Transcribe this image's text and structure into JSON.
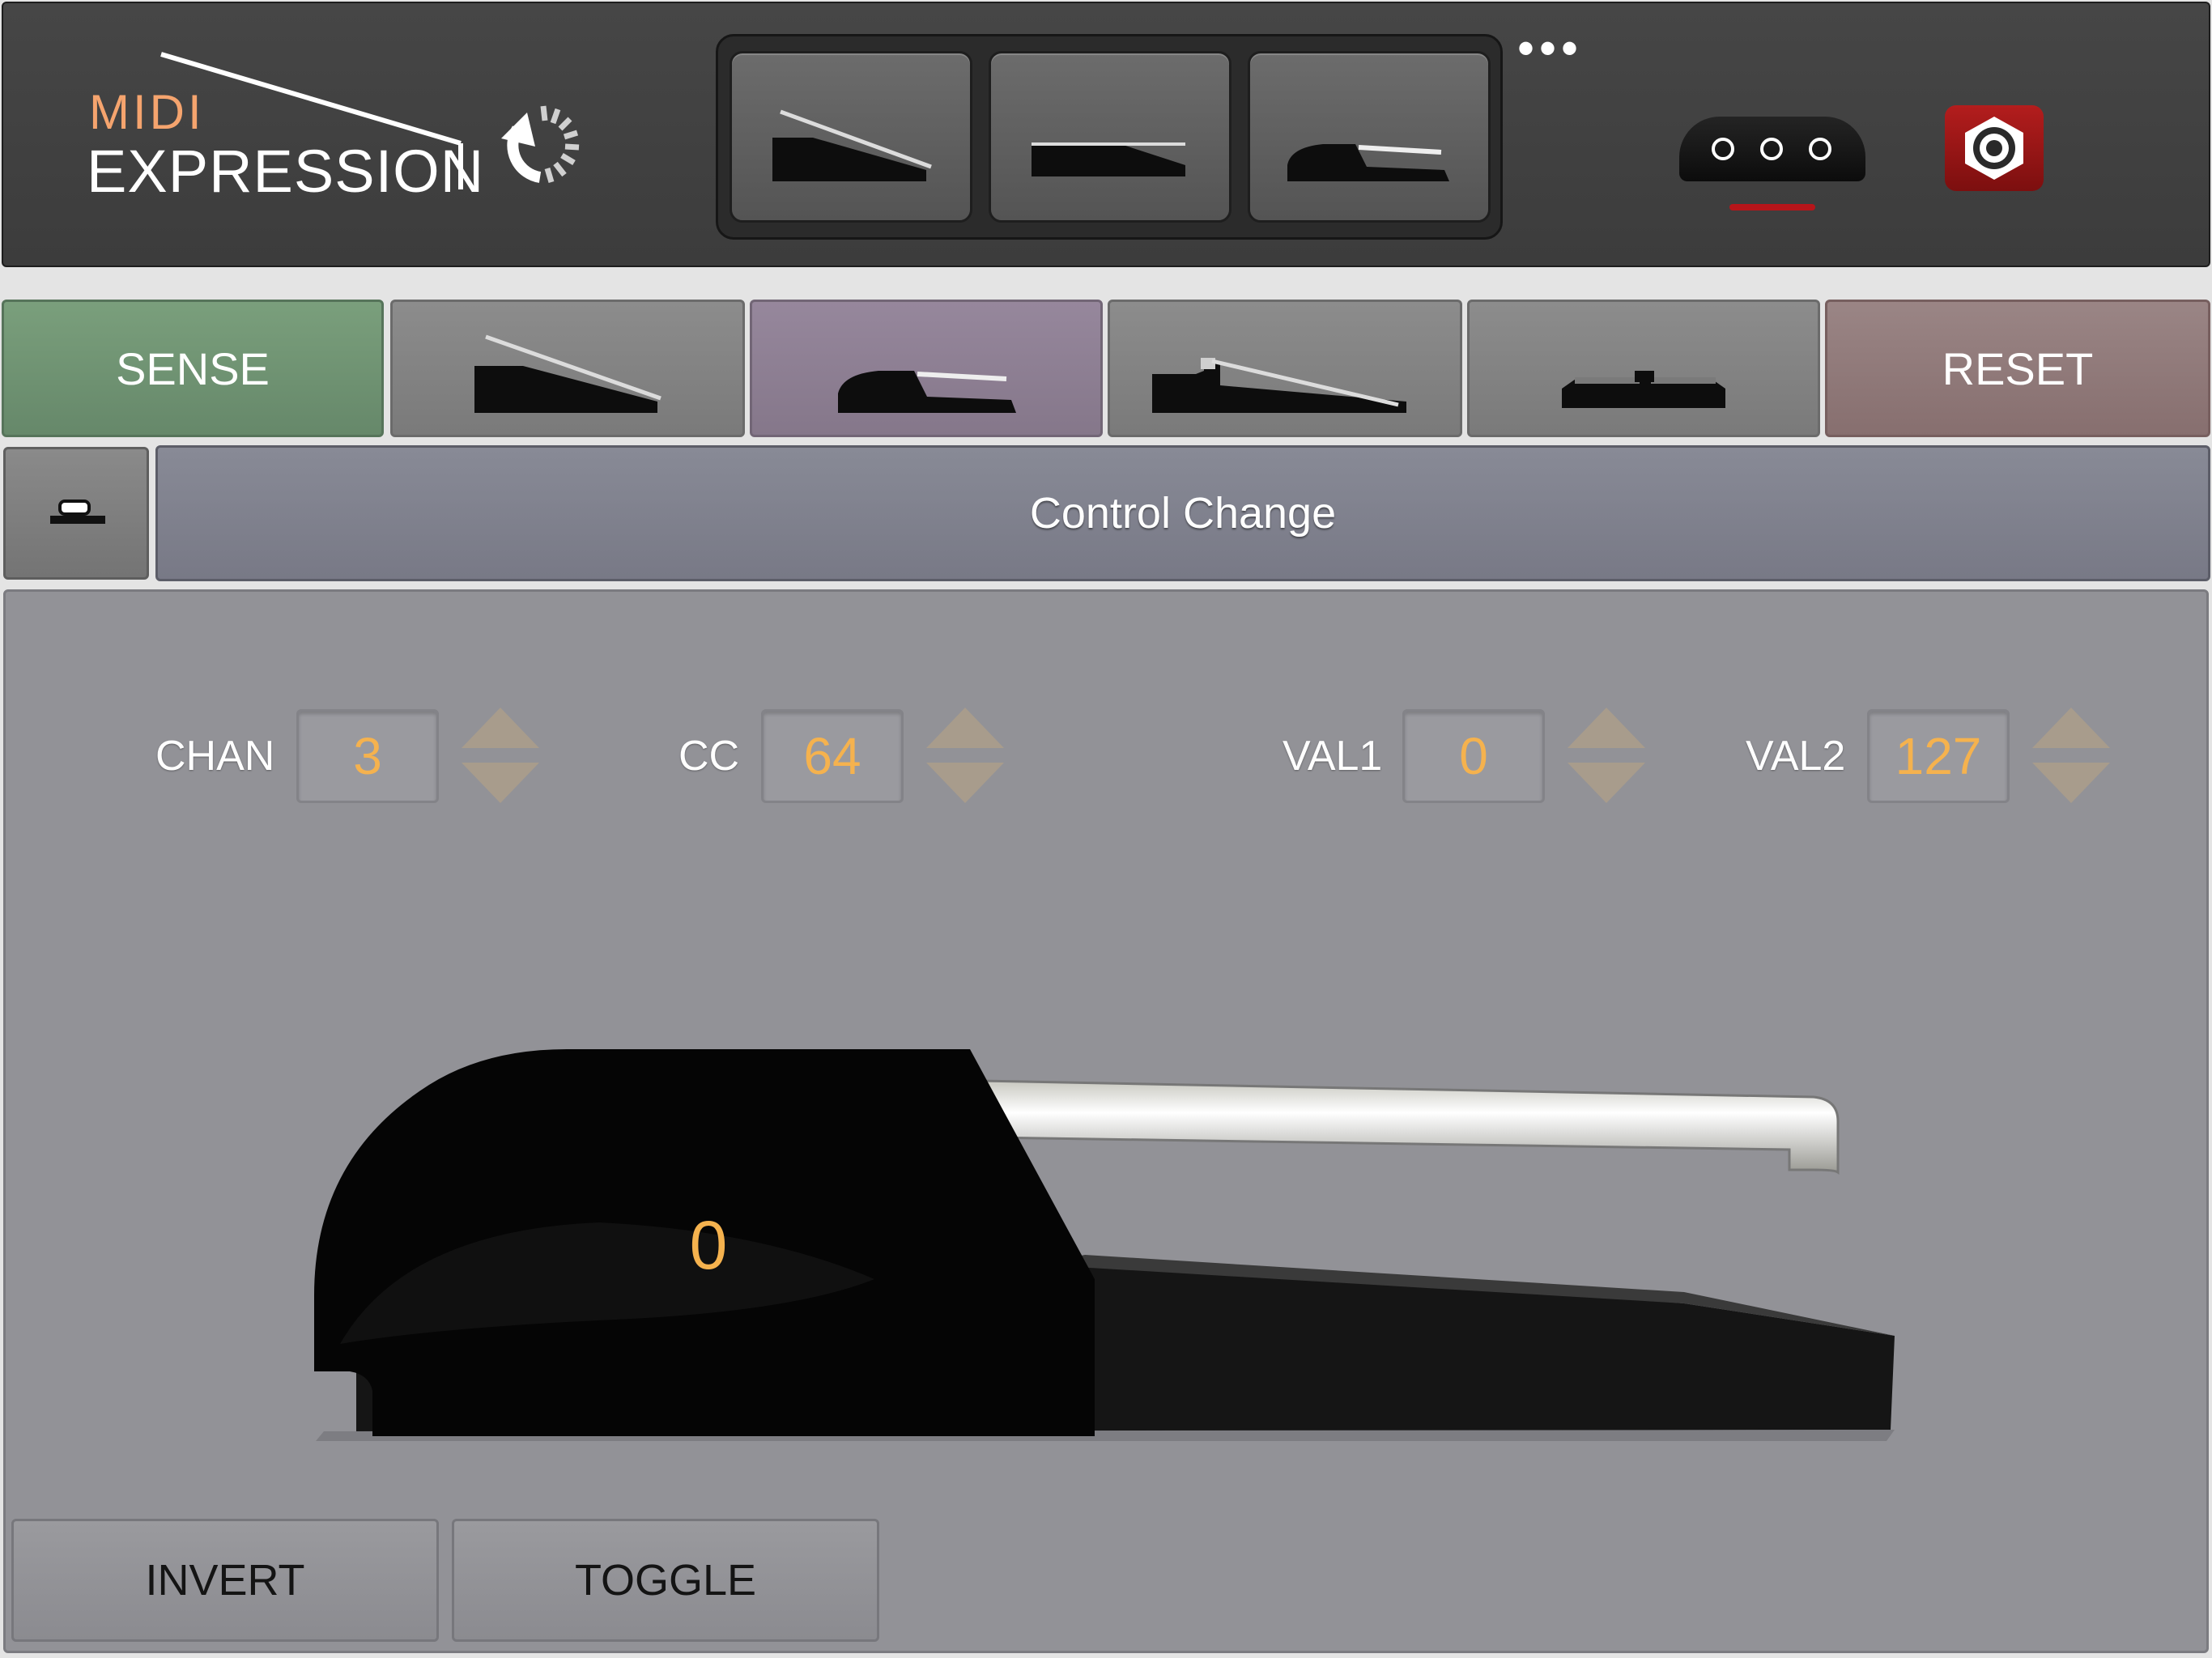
{
  "app": {
    "logo_line1": "MIDI",
    "logo_line2": "EXPRESSION"
  },
  "header": {
    "presets": [
      {
        "icon": "expression-pedal-icon"
      },
      {
        "icon": "flat-expression-pedal-icon"
      },
      {
        "icon": "sustain-pedal-icon"
      }
    ],
    "more_icon": "more-dots-icon",
    "more_label": "•••",
    "device_icon": "midi-device-icon",
    "jack_icon": "jack-input-icon"
  },
  "mode_bar": {
    "sense_label": "SENSE",
    "reset_label": "RESET",
    "pedal_types": [
      {
        "icon": "expression-pedal-icon",
        "selected": false
      },
      {
        "icon": "sustain-pedal-icon",
        "selected": true
      },
      {
        "icon": "piano-pedal-icon",
        "selected": false
      },
      {
        "icon": "footswitch-icon",
        "selected": false
      }
    ]
  },
  "message_bar": {
    "type_label": "Control Change",
    "mini_icon": "small-switch-icon"
  },
  "fields": {
    "chan": {
      "label": "CHAN",
      "value": "3"
    },
    "cc": {
      "label": "CC",
      "value": "64"
    },
    "val1": {
      "label": "VAL1",
      "value": "0"
    },
    "val2": {
      "label": "VAL2",
      "value": "127"
    }
  },
  "pedal": {
    "value": "0"
  },
  "bottom_buttons": {
    "invert_label": "INVERT",
    "toggle_label": "TOGGLE"
  },
  "colors": {
    "accent_value": "#f5b24e",
    "sense_green": "#6f9472",
    "selected_purple": "#8c7e91",
    "reset_rose": "#8f7a7a",
    "alert_red": "#b7151a"
  }
}
